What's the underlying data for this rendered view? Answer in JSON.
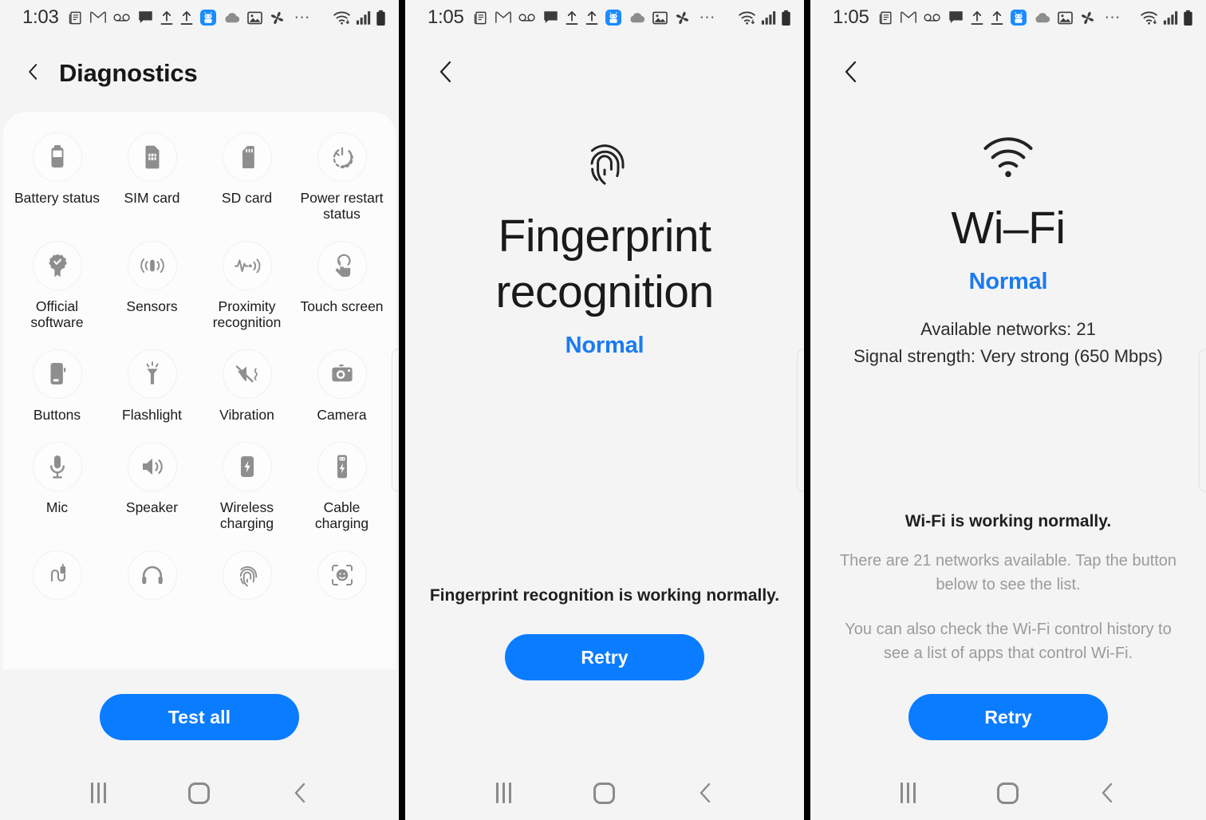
{
  "status_bar": {
    "time_a": "1:03",
    "time_b": "1:05",
    "time_c": "1:05",
    "icons": [
      "news-icon",
      "gmail-icon",
      "voicemail-icon",
      "message-icon",
      "upload-icon",
      "upload-icon",
      "android-bot-icon",
      "cloud-icon",
      "photos-icon",
      "pinwheel-icon",
      "overflow-dots-icon"
    ],
    "right_icons": [
      "wifi-icon",
      "cellular-signal-icon",
      "battery-icon"
    ],
    "overflow": "⋯"
  },
  "nav_bar": {
    "recents_label": "recents-button",
    "home_label": "home-button",
    "back_label": "back-button"
  },
  "panel_a": {
    "title": "Diagnostics",
    "tiles": [
      {
        "label": "Battery status",
        "icon": "battery-icon"
      },
      {
        "label": "SIM card",
        "icon": "sim-card-icon"
      },
      {
        "label": "SD card",
        "icon": "sd-card-icon"
      },
      {
        "label": "Power restart status",
        "icon": "power-restart-icon"
      },
      {
        "label": "Official software",
        "icon": "verified-badge-icon"
      },
      {
        "label": "Sensors",
        "icon": "sensors-icon"
      },
      {
        "label": "Proximity recognition",
        "icon": "proximity-icon"
      },
      {
        "label": "Touch screen",
        "icon": "touch-screen-icon"
      },
      {
        "label": "Buttons",
        "icon": "buttons-icon"
      },
      {
        "label": "Flashlight",
        "icon": "flashlight-icon"
      },
      {
        "label": "Vibration",
        "icon": "vibration-mute-icon"
      },
      {
        "label": "Camera",
        "icon": "camera-icon"
      },
      {
        "label": "Mic",
        "icon": "mic-icon"
      },
      {
        "label": "Speaker",
        "icon": "speaker-icon"
      },
      {
        "label": "Wireless charging",
        "icon": "wireless-charging-icon"
      },
      {
        "label": "Cable charging",
        "icon": "cable-charging-icon"
      },
      {
        "label": "",
        "icon": "usb-cable-icon"
      },
      {
        "label": "",
        "icon": "headphones-icon"
      },
      {
        "label": "",
        "icon": "fingerprint-icon"
      },
      {
        "label": "",
        "icon": "face-recognition-icon"
      }
    ],
    "test_all_label": "Test all"
  },
  "panel_b": {
    "hero_icon": "fingerprint-icon",
    "title_line1": "Fingerprint",
    "title_line2": "recognition",
    "status": "Normal",
    "summary": "Fingerprint recognition is working normally.",
    "retry_label": "Retry"
  },
  "panel_c": {
    "hero_icon": "wifi-icon",
    "title": "Wi–Fi",
    "status": "Normal",
    "detail_line1": "Available networks: 21",
    "detail_line2": "Signal strength: Very strong (650 Mbps)",
    "summary": "Wi-Fi is working normally.",
    "muted_line1": "There are 21 networks available. Tap the button below to see the list.",
    "muted_line2": "You can also check the Wi-Fi control history to see a list of apps that control Wi-Fi.",
    "retry_label": "Retry"
  },
  "colors": {
    "accent_blue": "#0a7cff",
    "status_blue": "#1a7bf0",
    "page_bg": "#f4f4f5",
    "card_bg": "#fcfcfc",
    "muted_text": "#9b9b9b"
  }
}
